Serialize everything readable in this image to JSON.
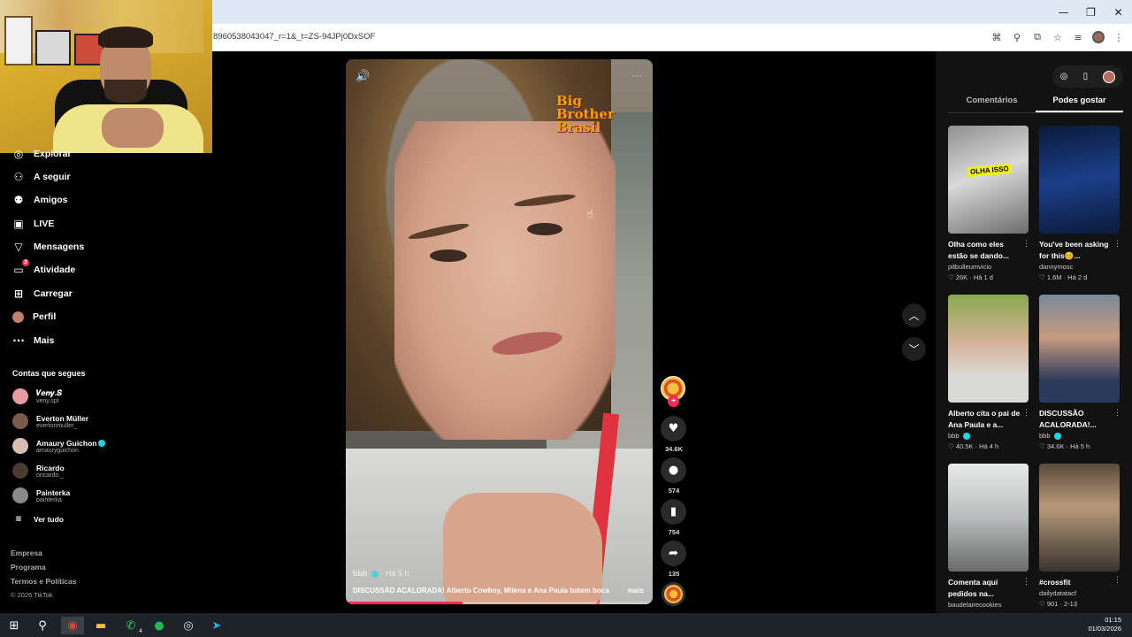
{
  "browser": {
    "url": "8960538043047_r=1&_t=ZS-94JPj0DxSOF",
    "window_controls": [
      "—",
      "❐",
      "✕"
    ],
    "icons": [
      "translate-icon",
      "zoom-icon",
      "install-icon",
      "star-icon",
      "media-icon",
      "profile-avatar",
      "menu-icon"
    ]
  },
  "sidebar": {
    "nav": [
      {
        "label": "Explorar",
        "icon": "compass-icon"
      },
      {
        "label": "A seguir",
        "icon": "person-plus-icon"
      },
      {
        "label": "Amigos",
        "icon": "friends-icon"
      },
      {
        "label": "LIVE",
        "icon": "live-icon"
      },
      {
        "label": "Mensagens",
        "icon": "send-icon"
      },
      {
        "label": "Atividade",
        "icon": "inbox-icon",
        "badge": "3"
      },
      {
        "label": "Carregar",
        "icon": "upload-icon"
      },
      {
        "label": "Perfil",
        "icon": "profile-avatar"
      },
      {
        "label": "Mais",
        "icon": "more-icon"
      }
    ],
    "following_title": "Contas que segues",
    "accounts": [
      {
        "name": "𝑽𝒆𝒏𝒚.𝑺",
        "user": "veny.spt",
        "verified": false,
        "color": "#e89aa5"
      },
      {
        "name": "Everton Müller",
        "user": "evertonmuller_",
        "verified": false,
        "color": "#7a5a4a"
      },
      {
        "name": "Amaury Guichon",
        "user": "amauryguichon",
        "verified": true,
        "color": "#d8c0b0"
      },
      {
        "name": "Ricardo",
        "user": "oricardo._",
        "verified": false,
        "color": "#4a3a30"
      },
      {
        "name": "Painterka",
        "user": "painterka",
        "verified": false,
        "color": "#8a8a8a"
      }
    ],
    "see_all": "Ver tudo",
    "footer_links": [
      "Empresa",
      "Programa",
      "Termos e Políticas"
    ],
    "copyright": "© 2026 TikTok"
  },
  "video": {
    "logo_text": "Big Brother Brasil",
    "author": "bbb",
    "time": "· Há 5 h",
    "caption": "DISCUSSÃO ACALORADA! Alberto Cowboy, Milena e Ana Paula batem boca",
    "more_label": "mais",
    "progress_fraction": 0.38
  },
  "actions": {
    "likes": "34.6K",
    "comments": "574",
    "saves": "754",
    "shares": "135"
  },
  "right_panel": {
    "tabs": [
      "Comentários",
      "Podes gostar"
    ],
    "active_tab": 1,
    "cards": [
      {
        "title": "Olha como eles estão se dando...",
        "user": "pitbulleumvicio",
        "likes": "26K",
        "time": "Há 1 d",
        "tag": "OLHA ISSO",
        "verified": false
      },
      {
        "title": "You've been asking for this😊...",
        "user": "dannymosc",
        "likes": "1.6M",
        "time": "Há 2 d",
        "tag": "",
        "verified": false
      },
      {
        "title": "Alberto cita o pai de Ana Paula e a...",
        "user": "bbb",
        "likes": "40.5K",
        "time": "Há 4 h",
        "tag": "",
        "verified": true
      },
      {
        "title": "DISCUSSÃO ACALORADA!...",
        "user": "bbb",
        "likes": "34.6K",
        "time": "Há 5 h",
        "tag": "",
        "verified": true
      },
      {
        "title": "Comenta aqui pedidos na...",
        "user": "baudelairecookies",
        "likes": "",
        "time": "",
        "tag": "",
        "verified": false
      },
      {
        "title": "#crossfit",
        "user": "dailydatatacf",
        "likes": "901",
        "time": "2-13",
        "tag": "",
        "verified": false
      }
    ]
  },
  "taskbar": {
    "time": "01:15",
    "date": "01/03/2026",
    "whatsapp_badge": "4"
  }
}
